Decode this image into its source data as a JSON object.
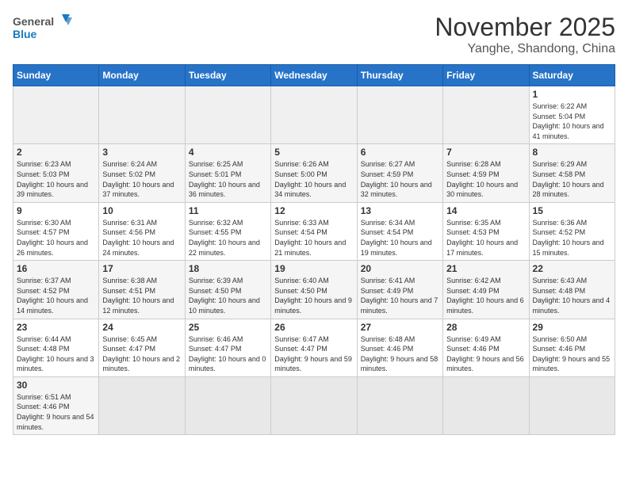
{
  "header": {
    "logo_text_general": "General",
    "logo_text_blue": "Blue",
    "month_title": "November 2025",
    "location": "Yanghe, Shandong, China"
  },
  "weekdays": [
    "Sunday",
    "Monday",
    "Tuesday",
    "Wednesday",
    "Thursday",
    "Friday",
    "Saturday"
  ],
  "weeks": [
    [
      {
        "day": "",
        "info": ""
      },
      {
        "day": "",
        "info": ""
      },
      {
        "day": "",
        "info": ""
      },
      {
        "day": "",
        "info": ""
      },
      {
        "day": "",
        "info": ""
      },
      {
        "day": "",
        "info": ""
      },
      {
        "day": "1",
        "info": "Sunrise: 6:22 AM\nSunset: 5:04 PM\nDaylight: 10 hours and 41 minutes."
      }
    ],
    [
      {
        "day": "2",
        "info": "Sunrise: 6:23 AM\nSunset: 5:03 PM\nDaylight: 10 hours and 39 minutes."
      },
      {
        "day": "3",
        "info": "Sunrise: 6:24 AM\nSunset: 5:02 PM\nDaylight: 10 hours and 37 minutes."
      },
      {
        "day": "4",
        "info": "Sunrise: 6:25 AM\nSunset: 5:01 PM\nDaylight: 10 hours and 36 minutes."
      },
      {
        "day": "5",
        "info": "Sunrise: 6:26 AM\nSunset: 5:00 PM\nDaylight: 10 hours and 34 minutes."
      },
      {
        "day": "6",
        "info": "Sunrise: 6:27 AM\nSunset: 4:59 PM\nDaylight: 10 hours and 32 minutes."
      },
      {
        "day": "7",
        "info": "Sunrise: 6:28 AM\nSunset: 4:59 PM\nDaylight: 10 hours and 30 minutes."
      },
      {
        "day": "8",
        "info": "Sunrise: 6:29 AM\nSunset: 4:58 PM\nDaylight: 10 hours and 28 minutes."
      }
    ],
    [
      {
        "day": "9",
        "info": "Sunrise: 6:30 AM\nSunset: 4:57 PM\nDaylight: 10 hours and 26 minutes."
      },
      {
        "day": "10",
        "info": "Sunrise: 6:31 AM\nSunset: 4:56 PM\nDaylight: 10 hours and 24 minutes."
      },
      {
        "day": "11",
        "info": "Sunrise: 6:32 AM\nSunset: 4:55 PM\nDaylight: 10 hours and 22 minutes."
      },
      {
        "day": "12",
        "info": "Sunrise: 6:33 AM\nSunset: 4:54 PM\nDaylight: 10 hours and 21 minutes."
      },
      {
        "day": "13",
        "info": "Sunrise: 6:34 AM\nSunset: 4:54 PM\nDaylight: 10 hours and 19 minutes."
      },
      {
        "day": "14",
        "info": "Sunrise: 6:35 AM\nSunset: 4:53 PM\nDaylight: 10 hours and 17 minutes."
      },
      {
        "day": "15",
        "info": "Sunrise: 6:36 AM\nSunset: 4:52 PM\nDaylight: 10 hours and 15 minutes."
      }
    ],
    [
      {
        "day": "16",
        "info": "Sunrise: 6:37 AM\nSunset: 4:52 PM\nDaylight: 10 hours and 14 minutes."
      },
      {
        "day": "17",
        "info": "Sunrise: 6:38 AM\nSunset: 4:51 PM\nDaylight: 10 hours and 12 minutes."
      },
      {
        "day": "18",
        "info": "Sunrise: 6:39 AM\nSunset: 4:50 PM\nDaylight: 10 hours and 10 minutes."
      },
      {
        "day": "19",
        "info": "Sunrise: 6:40 AM\nSunset: 4:50 PM\nDaylight: 10 hours and 9 minutes."
      },
      {
        "day": "20",
        "info": "Sunrise: 6:41 AM\nSunset: 4:49 PM\nDaylight: 10 hours and 7 minutes."
      },
      {
        "day": "21",
        "info": "Sunrise: 6:42 AM\nSunset: 4:49 PM\nDaylight: 10 hours and 6 minutes."
      },
      {
        "day": "22",
        "info": "Sunrise: 6:43 AM\nSunset: 4:48 PM\nDaylight: 10 hours and 4 minutes."
      }
    ],
    [
      {
        "day": "23",
        "info": "Sunrise: 6:44 AM\nSunset: 4:48 PM\nDaylight: 10 hours and 3 minutes."
      },
      {
        "day": "24",
        "info": "Sunrise: 6:45 AM\nSunset: 4:47 PM\nDaylight: 10 hours and 2 minutes."
      },
      {
        "day": "25",
        "info": "Sunrise: 6:46 AM\nSunset: 4:47 PM\nDaylight: 10 hours and 0 minutes."
      },
      {
        "day": "26",
        "info": "Sunrise: 6:47 AM\nSunset: 4:47 PM\nDaylight: 9 hours and 59 minutes."
      },
      {
        "day": "27",
        "info": "Sunrise: 6:48 AM\nSunset: 4:46 PM\nDaylight: 9 hours and 58 minutes."
      },
      {
        "day": "28",
        "info": "Sunrise: 6:49 AM\nSunset: 4:46 PM\nDaylight: 9 hours and 56 minutes."
      },
      {
        "day": "29",
        "info": "Sunrise: 6:50 AM\nSunset: 4:46 PM\nDaylight: 9 hours and 55 minutes."
      }
    ],
    [
      {
        "day": "30",
        "info": "Sunrise: 6:51 AM\nSunset: 4:46 PM\nDaylight: 9 hours and 54 minutes."
      },
      {
        "day": "",
        "info": ""
      },
      {
        "day": "",
        "info": ""
      },
      {
        "day": "",
        "info": ""
      },
      {
        "day": "",
        "info": ""
      },
      {
        "day": "",
        "info": ""
      },
      {
        "day": "",
        "info": ""
      }
    ]
  ]
}
